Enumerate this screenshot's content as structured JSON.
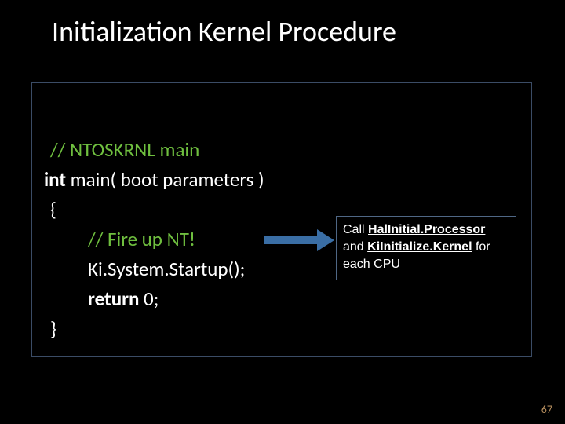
{
  "title": "Initialization Kernel Procedure",
  "code": {
    "l1": "// NTOSKRNL main",
    "l2_kw": "int",
    "l2_rest": " main( boot parameters )",
    "l3": "{",
    "l4": "// Fire up NT!",
    "l5": "Ki.System.Startup();",
    "l6_kw": "return",
    "l6_num": " 0;",
    "l7": "}"
  },
  "note": {
    "pre1": "Call ",
    "u1": "HalInitial.Processor",
    "mid": "and ",
    "u2": "KiInitialize.Kernel",
    "post": " for each CPU"
  },
  "page": "67"
}
